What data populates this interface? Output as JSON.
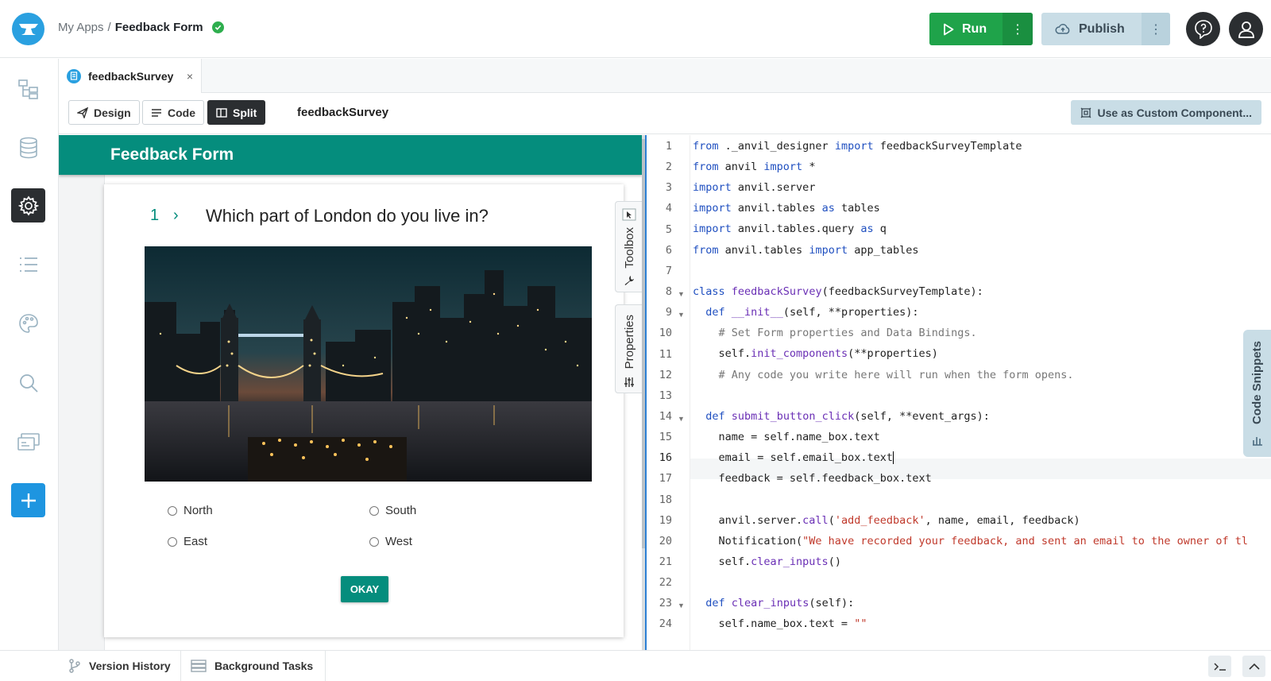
{
  "header": {
    "breadcrumb_parent": "My Apps",
    "breadcrumb_sep": "/",
    "app_name": "Feedback Form",
    "run_label": "Run",
    "publish_label": "Publish",
    "more_glyph": "⋮"
  },
  "sidebar": {
    "icons": [
      "app-tree-icon",
      "database-icon",
      "settings-icon",
      "list-icon",
      "palette-icon",
      "search-icon",
      "server-icon",
      "add-icon"
    ],
    "active": "settings-icon"
  },
  "editor_tab": {
    "label": "feedbackSurvey",
    "close": "×"
  },
  "modes": {
    "design": "Design",
    "code": "Code",
    "split": "Split",
    "active": "Split"
  },
  "form_name": "feedbackSurvey",
  "custom_component_label": "Use as Custom Component...",
  "form": {
    "header_title": "Feedback Form",
    "question_number": "1",
    "question_chevron": "›",
    "question_text": "Which part of London do you live in?",
    "options": [
      "North",
      "South",
      "East",
      "West"
    ],
    "okay_label": "OKAY"
  },
  "side_panels": {
    "toolbox": "Toolbox",
    "properties": "Properties"
  },
  "code_snippets_label": "Code Snippets",
  "code": {
    "line_numbers": [
      "1",
      "2",
      "3",
      "4",
      "5",
      "6",
      "7",
      "8",
      "9",
      "10",
      "11",
      "12",
      "13",
      "14",
      "15",
      "16",
      "17",
      "18",
      "19",
      "20",
      "21",
      "22",
      "23",
      "24"
    ],
    "current_line": "16"
  },
  "bottom": {
    "version_history": "Version History",
    "background_tasks": "Background Tasks"
  },
  "colors": {
    "accent_teal": "#058d7d",
    "run_green": "#1fa34a",
    "anvil_blue": "#2aa0e0",
    "publish_bg": "#c9dde6"
  }
}
